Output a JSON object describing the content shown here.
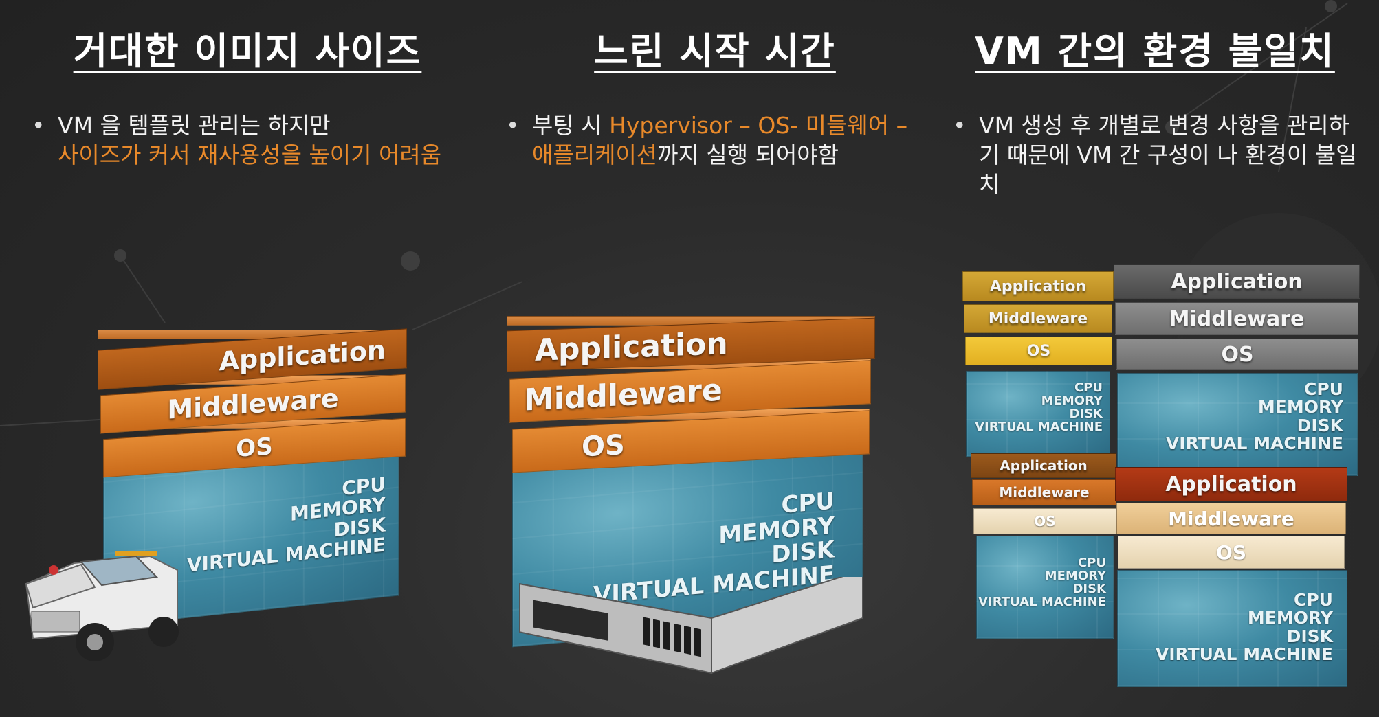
{
  "columns": [
    {
      "title": "거대한 이미지 사이즈",
      "bullet_marker": "•",
      "bullet_plain_1": "VM 을 템플릿 관리는 하지만",
      "bullet_highlight": "사이즈가 커서 재사용성을 높이기 어려움",
      "bullet_plain_2": "",
      "stack": {
        "layers": [
          "Application",
          "Middleware",
          "OS"
        ],
        "base_lines": [
          "CPU",
          "MEMORY",
          "DISK",
          "VIRTUAL MACHINE"
        ]
      },
      "carrier": "truck-icon"
    },
    {
      "title": "느린 시작 시간",
      "bullet_marker": "•",
      "bullet_plain_1": "부팅 시 ",
      "bullet_highlight": "Hypervisor – OS- 미들웨어 – 애플리케이션",
      "bullet_plain_2": "까지 실행 되어야함",
      "stack": {
        "layers": [
          "Application",
          "Middleware",
          "OS"
        ],
        "base_lines": [
          "CPU",
          "MEMORY",
          "DISK",
          "VIRTUAL MACHINE"
        ]
      },
      "carrier": "server-icon"
    },
    {
      "title": "VM 간의 환경 불일치",
      "bullet_marker": "•",
      "bullet_plain_1": "VM 생성 후 개별로 변경 사항을 관리하기 때문에 VM 간 구성이 나 환경이 불일치",
      "bullet_highlight": "",
      "bullet_plain_2": "",
      "stacks": [
        {
          "layers": [
            "Application",
            "Middleware",
            "OS"
          ],
          "base_lines": [
            "CPU",
            "MEMORY",
            "DISK",
            "VIRTUAL MACHINE"
          ]
        },
        {
          "layers": [
            "Application",
            "Middleware",
            "OS"
          ],
          "base_lines": [
            "CPU",
            "MEMORY",
            "DISK",
            "VIRTUAL MACHINE"
          ]
        },
        {
          "layers": [
            "Application",
            "Middleware",
            "OS"
          ],
          "base_lines": [
            "CPU",
            "MEMORY",
            "DISK",
            "VIRTUAL MACHINE"
          ]
        },
        {
          "layers": [
            "Application",
            "Middleware",
            "OS"
          ],
          "base_lines": [
            "CPU",
            "MEMORY",
            "DISK",
            "VIRTUAL MACHINE"
          ]
        }
      ]
    }
  ],
  "colors": {
    "background": "#2b2b2b",
    "highlight": "#e8892a",
    "layer_orange": "#d9782a",
    "water_blue": "#3f8aa3"
  }
}
